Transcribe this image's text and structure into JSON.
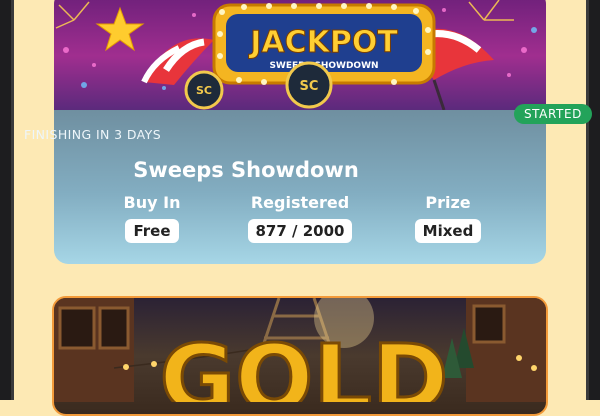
{
  "tournament_1": {
    "banner_sign": "JACKPOT",
    "banner_subtitle": "SWEEPS SHOWDOWN",
    "chip_label": "SC",
    "status_badge": "STARTED",
    "countdown": "FINISHING IN 3 DAYS",
    "title": "Sweeps Showdown",
    "stats": [
      {
        "label": "Buy In",
        "value": "Free"
      },
      {
        "label": "Registered",
        "value": "877 / 2000"
      },
      {
        "label": "Prize",
        "value": "Mixed"
      }
    ]
  },
  "tournament_2": {
    "banner_text": "GOLD"
  },
  "colors": {
    "page_background": "#fde9b4",
    "status_started": "#23a35a",
    "card_info_gradient_top": "#6f8fa0",
    "card_info_gradient_bottom": "#a6d6e6",
    "card2_border": "#f39b3a"
  }
}
